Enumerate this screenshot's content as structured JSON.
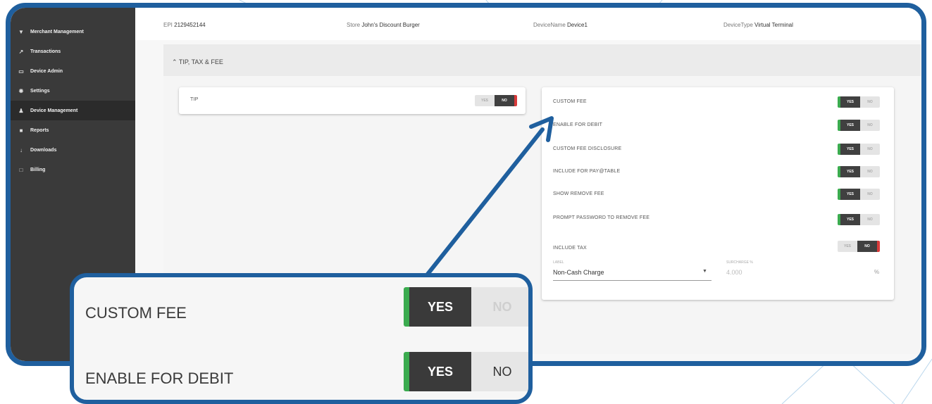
{
  "colors": {
    "frame": "#1f5f9e",
    "toggle_on": "#3bab4f",
    "toggle_off_marker": "#d83a3a",
    "sidebar": "#3a3a3a"
  },
  "sidebar": {
    "items": [
      {
        "icon": "store-icon",
        "label": "Merchant Management"
      },
      {
        "icon": "trend-icon",
        "label": "Transactions"
      },
      {
        "icon": "device-icon",
        "label": "Device Admin"
      },
      {
        "icon": "gear-icon",
        "label": "Settings"
      },
      {
        "icon": "user-icon",
        "label": "Device Management"
      },
      {
        "icon": "file-icon",
        "label": "Reports"
      },
      {
        "icon": "download-icon",
        "label": "Downloads"
      },
      {
        "icon": "billing-icon",
        "label": "Billing"
      }
    ]
  },
  "info": {
    "epi_label": "EPI",
    "epi_value": "2129452144",
    "store_label": "Store",
    "store_value": "John's Discount Burger",
    "device_name_label": "DeviceName",
    "device_name_value": "Device1",
    "device_type_label": "DeviceType",
    "device_type_value": "Virtual Terminal"
  },
  "section": {
    "title": "TIP, TAX & FEE"
  },
  "tip": {
    "label": "TIP",
    "yes": "YES",
    "no": "NO"
  },
  "fee_settings": [
    {
      "label": "CUSTOM FEE",
      "yes": "YES",
      "no": "NO"
    },
    {
      "label": "ENABLE FOR DEBIT",
      "yes": "YES",
      "no": "NO"
    },
    {
      "label": "CUSTOM FEE DISCLOSURE",
      "yes": "YES",
      "no": "NO"
    },
    {
      "label": "INCLUDE FOR PAY@TABLE",
      "yes": "YES",
      "no": "NO"
    },
    {
      "label": "SHOW REMOVE FEE",
      "yes": "YES",
      "no": "NO"
    },
    {
      "label": "PROMPT PASSWORD TO REMOVE FEE",
      "yes": "YES",
      "no": "NO"
    },
    {
      "label": "INCLUDE TAX",
      "yes": "YES",
      "no": "NO"
    }
  ],
  "fee_fields": {
    "label_caption": "LABEL",
    "label_value": "Non-Cash Charge",
    "surcharge_caption": "SURCHARGE %",
    "surcharge_value": "4.000",
    "percent_symbol": "%"
  },
  "zoom": {
    "row1_label": "CUSTOM FEE",
    "row1_yes": "YES",
    "row1_no": "NO",
    "row2_label": "ENABLE FOR DEBIT",
    "row2_yes": "YES",
    "row2_no": "NO"
  }
}
